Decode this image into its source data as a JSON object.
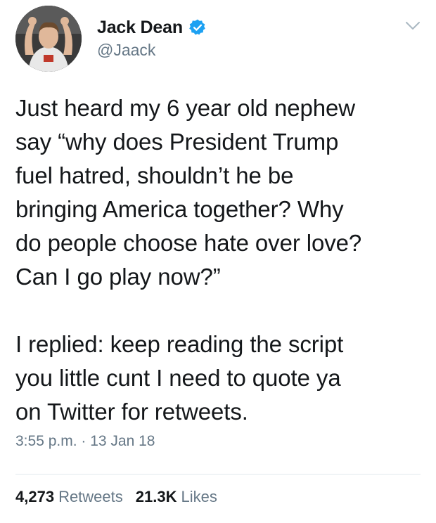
{
  "user": {
    "display_name": "Jack Dean",
    "handle": "@Jaack"
  },
  "tweet": {
    "text": "Just heard my 6 year old nephew\nsay “why does President Trump\nfuel hatred, shouldn’t he be\nbringing America together? Why\ndo people choose hate over love?\nCan I go play now?”\n\nI replied: keep reading the script\nyou little cunt I need to quote ya\non Twitter for retweets.",
    "timestamp": "3:55 p.m. · 13 Jan 18"
  },
  "stats": {
    "retweets_count": "4,273",
    "retweets_label": "Retweets",
    "likes_count": "21.3K",
    "likes_label": "Likes"
  },
  "icons": {
    "verified": "verified-badge-icon",
    "caret": "chevron-down-icon"
  },
  "colors": {
    "verified_blue": "#1da1f2",
    "secondary_text": "#657786",
    "primary_text": "#14171a"
  }
}
